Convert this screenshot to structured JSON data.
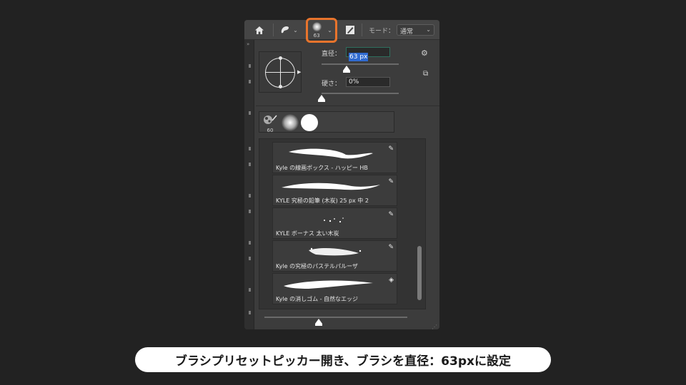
{
  "options_bar": {
    "home_icon": "home-icon",
    "tool_icon": "brush-tool-icon",
    "brush_size_badge": "63",
    "erase_icon": "brush-settings-toggle-icon",
    "mode_label": "モード：",
    "mode_value": "通常"
  },
  "picker": {
    "size_label": "直径：",
    "size_value": "63 px",
    "size_slider": 0.32,
    "hardness_label": "硬さ：",
    "hardness_value": "0%",
    "hardness_slider": 0.0,
    "settings_icon": "gear-icon",
    "new_preset_icon": "new-preset-icon",
    "recent_label": "60"
  },
  "brush_list": [
    {
      "label": "Kyle の線画ボックス - ハッピー HB",
      "icon": "brush-icon"
    },
    {
      "label": "KYLE 究極の鉛筆 (木炭) 25 px 中 2",
      "icon": "brush-icon"
    },
    {
      "label": "KYLE ボーナス 太い木炭",
      "icon": "brush-icon"
    },
    {
      "label": "Kyle の究極のパステルパルーザ",
      "icon": "brush-icon"
    },
    {
      "label": "Kyle の消しゴム - 自然なエッジ",
      "icon": "eraser-icon"
    }
  ],
  "caption": "ブラシプリセットピッカー開き、ブラシを直径：63pxに設定",
  "colors": {
    "highlight": "#e8742c",
    "selection": "#2f6ad0",
    "panel": "#3c3c3c"
  }
}
